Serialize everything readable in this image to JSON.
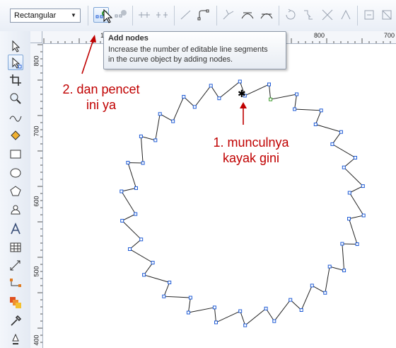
{
  "property_bar": {
    "mode_select": {
      "value": "Rectangular"
    }
  },
  "toolbar_icons": [
    "add-nodes-icon",
    "delete-nodes-icon",
    "join-nodes-icon",
    "break-curve-icon",
    "to-line-icon",
    "to-curve-icon",
    "cusp-node-icon",
    "smooth-node-icon",
    "symmetrical-node-icon",
    "reverse-direction-icon",
    "extend-curve-icon",
    "extract-subpath-icon",
    "stretch-nodes-icon",
    "rotate-nodes-icon",
    "align-nodes-icon",
    "select-all-nodes-icon"
  ],
  "tooltip": {
    "title": "Add nodes",
    "body_line1": "Increase the number of editable line segments",
    "body_line2": "in the curve object by adding nodes."
  },
  "ruler_top": {
    "labels": [
      "1",
      "800",
      "700"
    ]
  },
  "ruler_left": {
    "labels": [
      "800",
      "700",
      "600",
      "500",
      "400"
    ]
  },
  "annotations": {
    "step2_line1": "2. dan pencet",
    "step2_line2": "ini ya",
    "step1_line1": "1. munculnya",
    "step1_line2": "kayak gini"
  },
  "colors": {
    "annotation_red": "#c00000",
    "node_blue": "#1e5bd6",
    "selected_node_green": "#3a9a2a"
  },
  "toolbox_icons": [
    "pick-tool-icon",
    "shape-tool-icon",
    "crop-tool-icon",
    "zoom-tool-icon",
    "freehand-tool-icon",
    "smart-fill-icon",
    "rectangle-tool-icon",
    "ellipse-tool-icon",
    "polygon-tool-icon",
    "basic-shapes-icon",
    "text-tool-icon",
    "table-tool-icon",
    "dimension-tool-icon",
    "connector-tool-icon",
    "blend-tool-icon",
    "eyedropper-tool-icon",
    "outline-tool-icon"
  ]
}
